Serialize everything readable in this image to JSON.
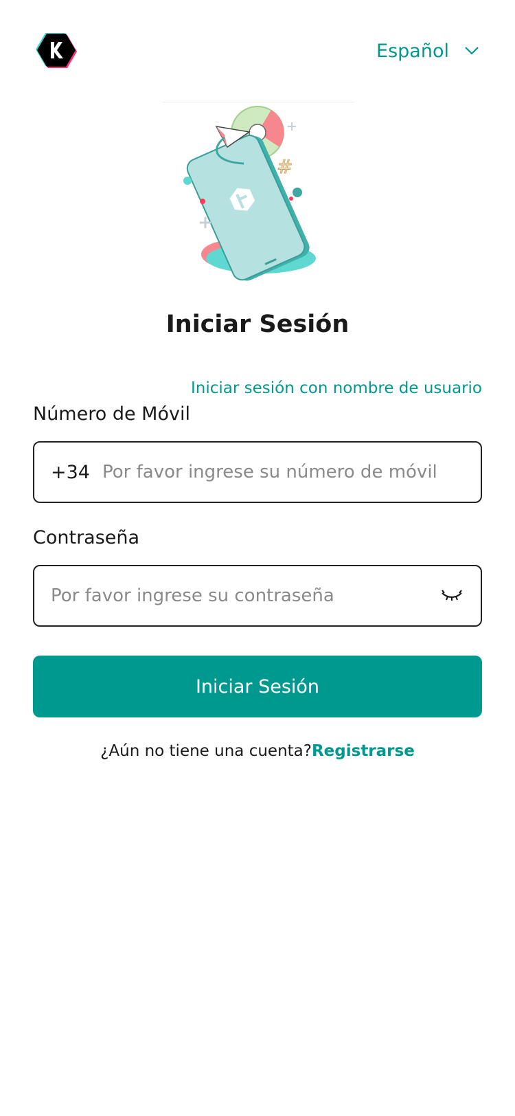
{
  "header": {
    "logo_icon": "k-hexagon-logo-icon",
    "language": "Español",
    "language_icon": "chevron-down-icon"
  },
  "main": {
    "illustration": "phone-illustration",
    "title": "Iniciar Sesión",
    "alt_login_link": "Iniciar sesión con nombre de usuario",
    "mobile": {
      "label": "Número de Móvil",
      "prefix": "+34",
      "placeholder": "Por favor ingrese su número de móvil",
      "value": ""
    },
    "password": {
      "label": "Contraseña",
      "placeholder": "Por favor ingrese su contraseña",
      "value": "",
      "toggle_icon": "eye-closed-icon"
    },
    "submit_label": "Iniciar Sesión",
    "register": {
      "prompt": "¿Aún no tiene una cuenta?",
      "link": "Registrarse"
    }
  },
  "colors": {
    "accent": "#00998f",
    "text": "#1a1a1a",
    "placeholder": "#8a8a8a",
    "border": "#222222"
  }
}
